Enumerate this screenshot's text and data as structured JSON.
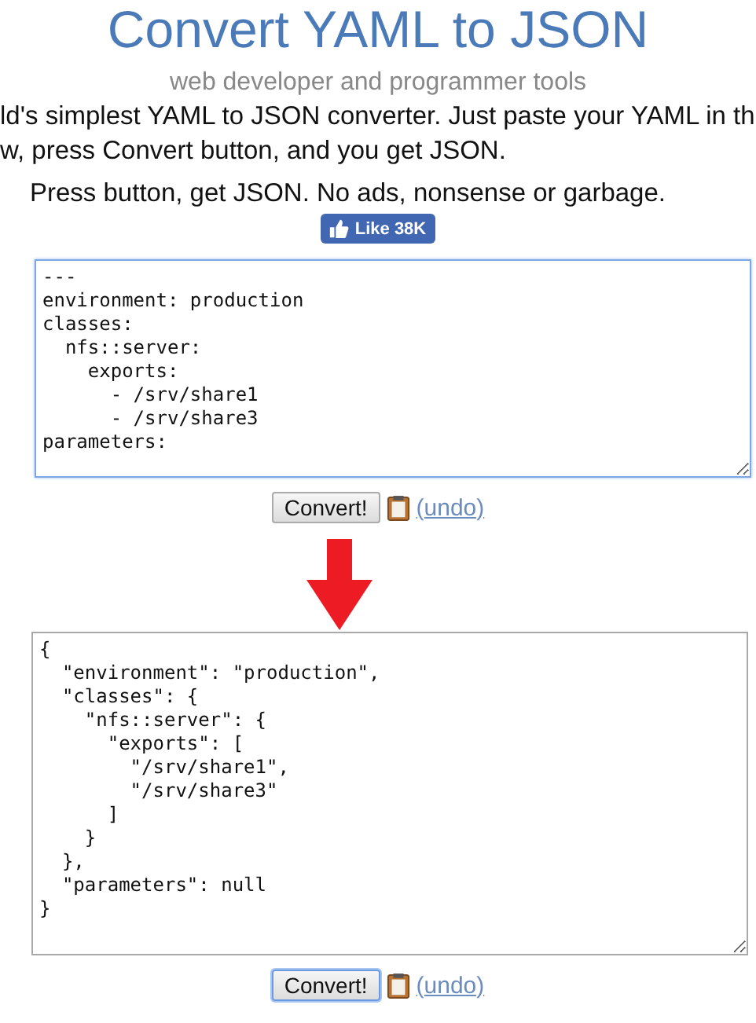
{
  "header": {
    "title": "Convert YAML to JSON",
    "subtitle": "web developer and programmer tools"
  },
  "intro": {
    "lines": [
      "ld's simplest YAML to JSON converter. Just paste your YAML in th",
      "w, press Convert button, and you get JSON."
    ],
    "tagline": "Press button, get JSON. No ads, nonsense or garbage."
  },
  "like_button": {
    "label": "Like 38K"
  },
  "panels": [
    {
      "kind": "input",
      "value": "---\nenvironment: production\nclasses:\n  nfs::server:\n    exports:\n      - /srv/share1\n      - /srv/share3\nparameters:",
      "focused": true,
      "button": {
        "label": "Convert!",
        "focused": false
      },
      "undo": "(undo)"
    },
    {
      "kind": "output",
      "value": "{\n  \"environment\": \"production\",\n  \"classes\": {\n    \"nfs::server\": {\n      \"exports\": [\n        \"/srv/share1\",\n        \"/srv/share3\"\n      ]\n    }\n  },\n  \"parameters\": null\n}",
      "focused": false,
      "button": {
        "label": "Convert!",
        "focused": true
      },
      "undo": "(undo)"
    }
  ]
}
